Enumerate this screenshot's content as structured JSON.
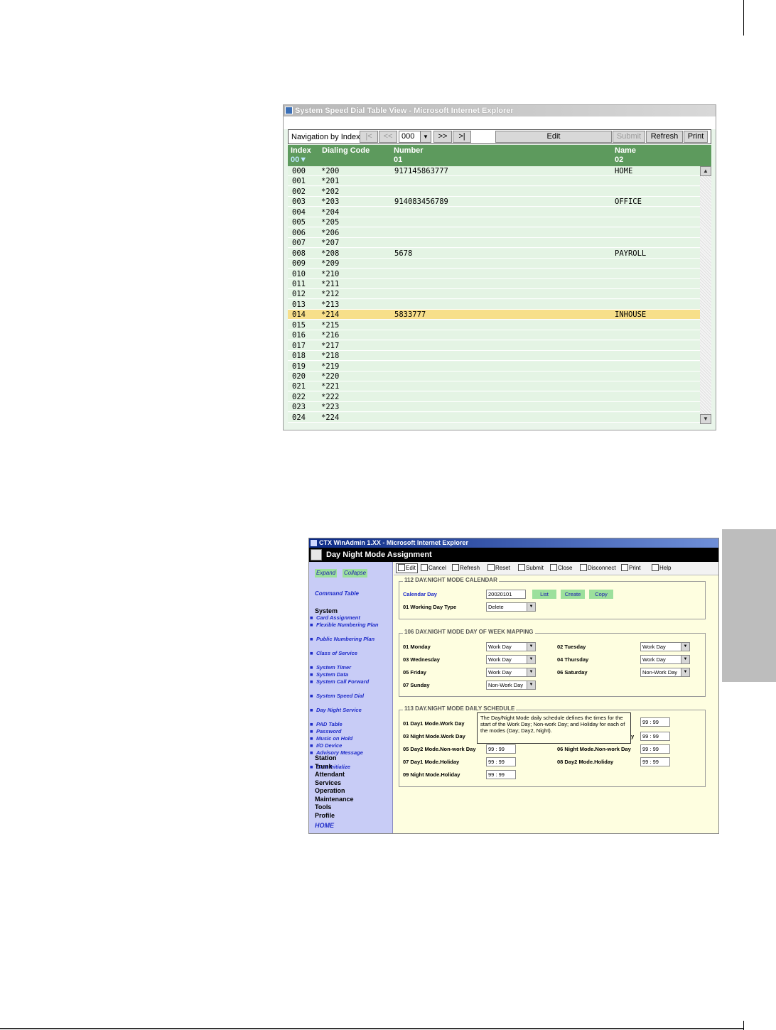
{
  "speed_dial_window": {
    "title": "System Speed Dial Table View - Microsoft Internet Explorer",
    "toolbar": {
      "nav_label": "Navigation by Index",
      "first": "|<",
      "prev": "<<",
      "index_value": "000",
      "next": ">>",
      "last": ">|",
      "edit": "Edit",
      "submit": "Submit",
      "refresh": "Refresh",
      "print": "Print"
    },
    "columns": {
      "index": "Index",
      "index_sub": "00",
      "dialing_code": "Dialing Code",
      "number": "Number",
      "number_sub": "01",
      "name": "Name",
      "name_sub": "02"
    },
    "rows": [
      {
        "index": "000",
        "code": "*200",
        "number": "917145863777",
        "name": "HOME"
      },
      {
        "index": "001",
        "code": "*201",
        "number": "",
        "name": ""
      },
      {
        "index": "002",
        "code": "*202",
        "number": "",
        "name": ""
      },
      {
        "index": "003",
        "code": "*203",
        "number": "914083456789",
        "name": "OFFICE"
      },
      {
        "index": "004",
        "code": "*204",
        "number": "",
        "name": ""
      },
      {
        "index": "005",
        "code": "*205",
        "number": "",
        "name": ""
      },
      {
        "index": "006",
        "code": "*206",
        "number": "",
        "name": ""
      },
      {
        "index": "007",
        "code": "*207",
        "number": "",
        "name": ""
      },
      {
        "index": "008",
        "code": "*208",
        "number": "5678",
        "name": "PAYROLL"
      },
      {
        "index": "009",
        "code": "*209",
        "number": "",
        "name": ""
      },
      {
        "index": "010",
        "code": "*210",
        "number": "",
        "name": ""
      },
      {
        "index": "011",
        "code": "*211",
        "number": "",
        "name": ""
      },
      {
        "index": "012",
        "code": "*212",
        "number": "",
        "name": ""
      },
      {
        "index": "013",
        "code": "*213",
        "number": "",
        "name": ""
      },
      {
        "index": "014",
        "code": "*214",
        "number": "5833777",
        "name": "INHOUSE",
        "selected": true
      },
      {
        "index": "015",
        "code": "*215",
        "number": "",
        "name": ""
      },
      {
        "index": "016",
        "code": "*216",
        "number": "",
        "name": ""
      },
      {
        "index": "017",
        "code": "*217",
        "number": "",
        "name": ""
      },
      {
        "index": "018",
        "code": "*218",
        "number": "",
        "name": ""
      },
      {
        "index": "019",
        "code": "*219",
        "number": "",
        "name": ""
      },
      {
        "index": "020",
        "code": "*220",
        "number": "",
        "name": ""
      },
      {
        "index": "021",
        "code": "*221",
        "number": "",
        "name": ""
      },
      {
        "index": "022",
        "code": "*222",
        "number": "",
        "name": ""
      },
      {
        "index": "023",
        "code": "*223",
        "number": "",
        "name": ""
      },
      {
        "index": "024",
        "code": "*224",
        "number": "",
        "name": ""
      }
    ]
  },
  "winadmin_window": {
    "title": "CTX WinAdmin 1.XX - Microsoft Internet Explorer",
    "app_title": "Day Night Mode Assignment",
    "sidebar": {
      "expand": "Expand",
      "collapse": "Collapse",
      "command_table": "Command Table",
      "system": "System",
      "system_items": [
        "Card Assignment",
        "Flexible Numbering Plan",
        "Public Numbering Plan",
        "Class of Service",
        "System Timer",
        "System Data",
        "System Call Forward",
        "System Speed Dial",
        "Day Night Service",
        "PAD Table",
        "Password",
        "Music on Hold",
        "I/O Device",
        "Advisory Message",
        "Data Initialize"
      ],
      "sections": [
        "Station",
        "Trunk",
        "Attendant",
        "Services",
        "Operation",
        "Maintenance",
        "Tools",
        "Profile"
      ],
      "home": "HOME"
    },
    "toolbar": [
      "Edit",
      "Cancel",
      "Refresh",
      "Reset",
      "Submit",
      "Close",
      "Disconnect",
      "Print",
      "Help"
    ],
    "calendar": {
      "legend": "112 DAY.NIGHT MODE CALENDAR",
      "calendar_day_label": "Calendar Day",
      "calendar_day_value": "20020101",
      "list": "List",
      "create": "Create",
      "copy": "Copy",
      "working_day_type_label": "01 Working Day Type",
      "working_day_type_value": "Delete"
    },
    "week_mapping": {
      "legend": "106 DAY.NIGHT MODE DAY OF WEEK MAPPING",
      "monday": "01 Monday",
      "monday_value": "Work Day",
      "tuesday": "02 Tuesday",
      "tuesday_value": "Work Day",
      "wednesday": "03 Wednesday",
      "wednesday_value": "Work Day",
      "thursday": "04 Thursday",
      "thursday_value": "Work Day",
      "friday": "05 Friday",
      "friday_value": "Work Day",
      "saturday": "06 Saturday",
      "saturday_value": "Non-Work Day",
      "sunday": "07 Sunday",
      "sunday_value": "Non-Work Day"
    },
    "daily_schedule": {
      "legend": "113 DAY.NIGHT MODE DAILY SCHEDULE",
      "f01": "01 Day1 Mode.Work Day",
      "f03": "03 Night Mode.Work Day",
      "f04_tail": "y",
      "f05": "05 Day2 Mode.Non-work Day",
      "f06": "06 Night Mode.Non-work Day",
      "f07": "07 Day1 Mode.Holiday",
      "f08": "08 Day2 Mode.Holiday",
      "f09": "09 Night Mode.Holiday",
      "time_value": "99 : 99",
      "tooltip": "The Day/Night Mode daily schedule defines the times for the start of the Work Day; Non-work Day; and Holiday for each of the modes (Day; Day2, Night)."
    }
  }
}
